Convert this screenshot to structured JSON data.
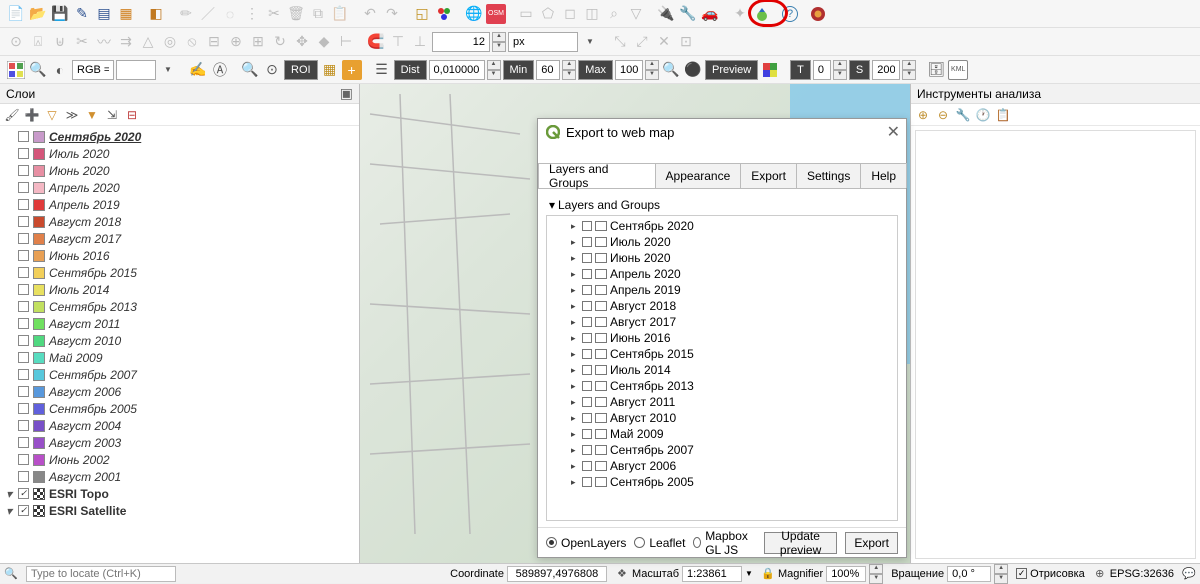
{
  "toolbar1": {
    "group1_count": 7,
    "group2_count": 9
  },
  "toolbar2": {
    "size_value": "12",
    "unit_value": "px"
  },
  "toolbar3": {
    "rgb_label": "RGB =",
    "roi_label": "ROI",
    "dist_label": "Dist",
    "dist_value": "0,010000",
    "min_label": "Min",
    "min_value": "60",
    "max_label": "Max",
    "max_value": "100",
    "preview_label": "Preview",
    "t_label": "T",
    "t_value": "0",
    "s_label": "S",
    "s_value": "200"
  },
  "left_panel": {
    "title": "Слои",
    "layers": [
      {
        "label": "Сентябрь 2020",
        "color": "#c89aca",
        "bold": true
      },
      {
        "label": "Июль 2020",
        "color": "#d4567a"
      },
      {
        "label": "Июнь 2020",
        "color": "#e78fa3"
      },
      {
        "label": "Апрель 2020",
        "color": "#f4b8c4"
      },
      {
        "label": "Апрель 2019",
        "color": "#e03a3a"
      },
      {
        "label": "Август 2018",
        "color": "#c94a2e"
      },
      {
        "label": "Август 2017",
        "color": "#e0804a"
      },
      {
        "label": "Июнь 2016",
        "color": "#e8a055"
      },
      {
        "label": "Сентябрь 2015",
        "color": "#f2cf5a"
      },
      {
        "label": "Июль 2014",
        "color": "#e8e060"
      },
      {
        "label": "Сентябрь 2013",
        "color": "#c2e060"
      },
      {
        "label": "Август 2011",
        "color": "#70e060"
      },
      {
        "label": "Август 2010",
        "color": "#50d880"
      },
      {
        "label": "Май 2009",
        "color": "#58dcc0"
      },
      {
        "label": "Сентябрь 2007",
        "color": "#58c8dc"
      },
      {
        "label": "Август 2006",
        "color": "#5898dc"
      },
      {
        "label": "Сентябрь 2005",
        "color": "#6060dc"
      },
      {
        "label": "Август 2004",
        "color": "#7850c8"
      },
      {
        "label": "Август 2003",
        "color": "#9850c8"
      },
      {
        "label": "Июнь 2002",
        "color": "#b850c8"
      },
      {
        "label": "Август 2001",
        "color": "#888888"
      }
    ],
    "esri_layers": [
      {
        "label": "ESRI Topo",
        "checked": true
      },
      {
        "label": "ESRI Satellite",
        "checked": true
      }
    ]
  },
  "right_panel": {
    "title": "Инструменты анализа"
  },
  "dialog": {
    "title": "Export to web map",
    "tabs": [
      "Layers and Groups",
      "Appearance",
      "Export",
      "Settings",
      "Help"
    ],
    "active_tab": 0,
    "tree_title": "Layers and Groups",
    "items": [
      "Сентябрь 2020",
      "Июль 2020",
      "Июнь 2020",
      "Апрель 2020",
      "Апрель 2019",
      "Август 2018",
      "Август 2017",
      "Июнь 2016",
      "Сентябрь 2015",
      "Июль 2014",
      "Сентябрь 2013",
      "Август 2011",
      "Август 2010",
      "Май 2009",
      "Сентябрь 2007",
      "Август 2006",
      "Сентябрь 2005"
    ],
    "footer": {
      "radio_openlayers": "OpenLayers",
      "radio_leaflet": "Leaflet",
      "radio_mapbox": "Mapbox GL JS",
      "update_btn": "Update preview",
      "export_btn": "Export"
    }
  },
  "statusbar": {
    "locate_placeholder": "Type to locate (Ctrl+K)",
    "coord_label": "Coordinate",
    "coord_value": "589897,4976808",
    "scale_label": "Масштаб",
    "scale_value": "1:23861",
    "magnifier_label": "Magnifier",
    "magnifier_value": "100%",
    "rotation_label": "Вращение",
    "rotation_value": "0,0 °",
    "render_label": "Отрисовка",
    "epsg_label": "EPSG:32636"
  }
}
